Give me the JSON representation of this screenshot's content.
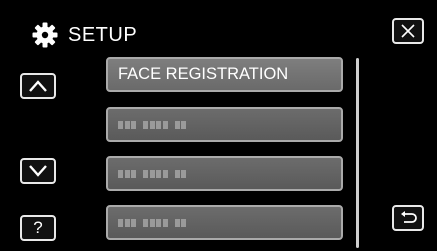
{
  "header": {
    "title": "SETUP",
    "icon": "gear-icon"
  },
  "menu": {
    "items": [
      {
        "label": "FACE REGISTRATION",
        "state": "active"
      },
      {
        "label": "",
        "state": "blurred"
      },
      {
        "label": "",
        "state": "blurred"
      },
      {
        "label": "",
        "state": "blurred"
      }
    ]
  },
  "controls": {
    "help_label": "?",
    "close_icon": "close-icon",
    "up_icon": "chevron-up-icon",
    "down_icon": "chevron-down-icon",
    "back_icon": "return-icon"
  },
  "colors": {
    "background": "#000000",
    "item_active": "#777777",
    "item_dim": "#626262",
    "border": "#e9e9e9"
  }
}
